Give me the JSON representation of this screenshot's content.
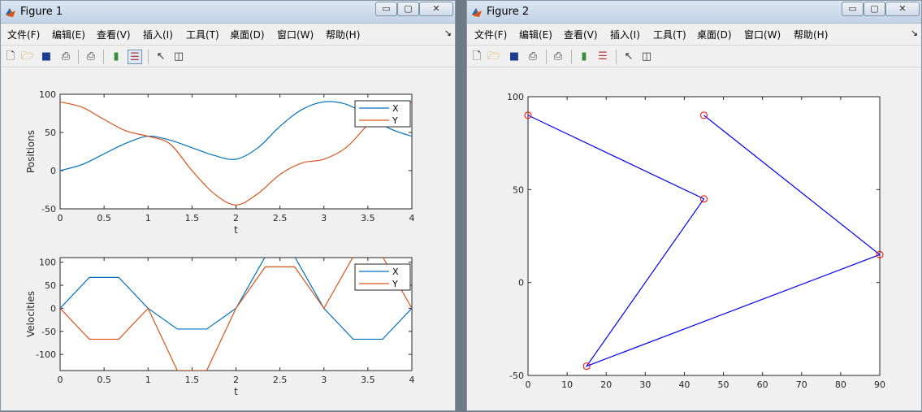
{
  "figure1": {
    "title": "Figure 1",
    "menu": [
      "文件(F)",
      "编辑(E)",
      "查看(V)",
      "插入(I)",
      "工具(T)",
      "桌面(D)",
      "窗口(W)",
      "帮助(H)"
    ],
    "dock_glyph": "↘",
    "window_buttons": {
      "minimize": "▭",
      "maximize": "▢",
      "close": "✕"
    }
  },
  "figure2": {
    "title": "Figure 2",
    "menu": [
      "文件(F)",
      "编辑(E)",
      "查看(V)",
      "插入(I)",
      "工具(T)",
      "桌面(D)",
      "窗口(W)",
      "帮助(H)"
    ],
    "dock_glyph": "↘",
    "window_buttons": {
      "minimize": "▭",
      "maximize": "▢",
      "close": "✕"
    }
  },
  "toolbar_icons": [
    "new-file-icon",
    "open-folder-icon",
    "save-icon",
    "print-icon",
    "print-preview-icon",
    "colorbar-icon",
    "legend-icon",
    "pointer-icon",
    "property-editor-icon"
  ],
  "colors": {
    "series_x": "#0072bd",
    "series_y": "#d95319",
    "trajectory": "#0000ff",
    "marker": "#ff0000"
  },
  "chart_data": [
    {
      "type": "line",
      "xlabel": "t",
      "ylabel": "Positions",
      "xlim": [
        0,
        4
      ],
      "ylim": [
        -50,
        100
      ],
      "xticks": [
        "0",
        "0.5",
        "1",
        "1.5",
        "2",
        "2.5",
        "3",
        "3.5",
        "4"
      ],
      "yticks": [
        "-50",
        "0",
        "50",
        "100"
      ],
      "legend_position": "top-right",
      "grid": false,
      "series": [
        {
          "name": "X",
          "x": [
            0,
            0.25,
            0.5,
            0.75,
            1,
            1.25,
            1.5,
            1.75,
            2,
            2.25,
            2.5,
            2.75,
            3,
            3.25,
            3.5,
            3.75,
            4
          ],
          "values": [
            0,
            8,
            22,
            36,
            45,
            40,
            30,
            20,
            15,
            30,
            58,
            80,
            90,
            87,
            72,
            55,
            45
          ]
        },
        {
          "name": "Y",
          "x": [
            0,
            0.25,
            0.5,
            0.75,
            1,
            1.25,
            1.5,
            1.75,
            2,
            2.25,
            2.5,
            2.75,
            3,
            3.25,
            3.5,
            3.75,
            4
          ],
          "values": [
            90,
            83,
            67,
            52,
            45,
            35,
            0,
            -30,
            -45,
            -30,
            -5,
            10,
            15,
            30,
            60,
            85,
            90
          ]
        }
      ]
    },
    {
      "type": "line",
      "xlabel": "t",
      "ylabel": "Velocities",
      "xlim": [
        0,
        4
      ],
      "ylim": [
        -135,
        110
      ],
      "xticks": [
        "0",
        "0.5",
        "1",
        "1.5",
        "2",
        "2.5",
        "3",
        "3.5",
        "4"
      ],
      "yticks": [
        "-100",
        "-50",
        "0",
        "50",
        "100"
      ],
      "legend_position": "top-right",
      "grid": false,
      "series": [
        {
          "name": "X",
          "x": [
            0,
            0.333,
            0.667,
            1,
            1.333,
            1.667,
            2,
            2.333,
            2.667,
            3,
            3.333,
            3.667,
            4
          ],
          "values": [
            0,
            67,
            67,
            0,
            -45,
            -45,
            0,
            112,
            112,
            0,
            -67,
            -67,
            0
          ]
        },
        {
          "name": "Y",
          "x": [
            0,
            0.333,
            0.667,
            1,
            1.333,
            1.667,
            2,
            2.333,
            2.667,
            3,
            3.333,
            3.667,
            4
          ],
          "values": [
            0,
            -67,
            -67,
            0,
            -135,
            -135,
            0,
            90,
            90,
            0,
            112,
            112,
            0
          ]
        }
      ]
    },
    {
      "type": "line",
      "xlim": [
        0,
        90
      ],
      "ylim": [
        -50,
        100
      ],
      "xticks": [
        "0",
        "10",
        "20",
        "30",
        "40",
        "50",
        "60",
        "70",
        "80",
        "90"
      ],
      "yticks": [
        "-50",
        "0",
        "50",
        "100"
      ],
      "grid": false,
      "marker": "circle",
      "series": [
        {
          "x": [
            0,
            45,
            15,
            90,
            45
          ],
          "values": [
            90,
            45,
            -45,
            15,
            90
          ]
        }
      ]
    }
  ]
}
